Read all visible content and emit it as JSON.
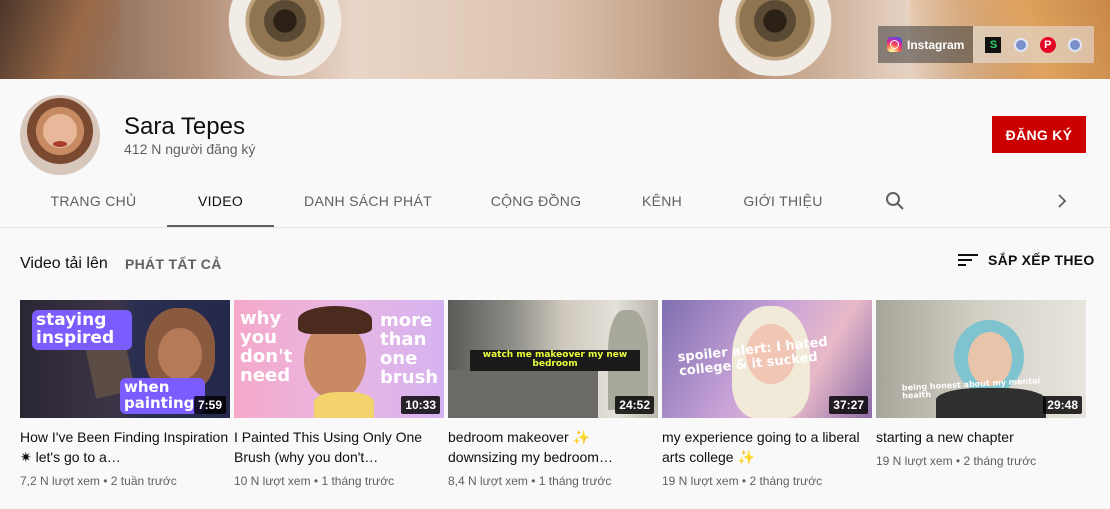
{
  "banner": {
    "links": {
      "primary_label": "Instagram",
      "icons": [
        "instagram-icon",
        "s-app-icon",
        "globe-icon",
        "pinterest-icon",
        "globe-icon"
      ]
    }
  },
  "channel": {
    "name": "Sara Tepes",
    "subscribers": "412 N người đăng ký",
    "subscribe_label": "ĐĂNG KÝ"
  },
  "tabs": [
    {
      "label": "TRANG CHỦ",
      "active": false
    },
    {
      "label": "VIDEO",
      "active": true
    },
    {
      "label": "DANH SÁCH PHÁT",
      "active": false
    },
    {
      "label": "CỘNG ĐỒNG",
      "active": false
    },
    {
      "label": "KÊNH",
      "active": false
    },
    {
      "label": "GIỚI THIỆU",
      "active": false
    }
  ],
  "section": {
    "title": "Video tải lên",
    "play_all": "PHÁT TẤT CẢ",
    "sort_label": "SẮP XẾP THEO"
  },
  "videos": [
    {
      "title": "How I've Been Finding Inspiration ✷ let's go to a…",
      "duration": "7:59",
      "views": "7,2 N lượt xem",
      "age": "2 tuần trước",
      "thumb_text": [
        "staying inspired",
        "when painting"
      ]
    },
    {
      "title": "I Painted This Using Only One Brush (why you don't…",
      "duration": "10:33",
      "views": "10 N lượt xem",
      "age": "1 tháng trước",
      "thumb_text": [
        "why you don't need",
        "more than one brush"
      ]
    },
    {
      "title": "bedroom makeover ✨ downsizing my bedroom…",
      "duration": "24:52",
      "views": "8,4 N lượt xem",
      "age": "1 tháng trước",
      "thumb_text": [
        "watch me makeover my new bedroom"
      ]
    },
    {
      "title": "my experience going to a liberal arts college ✨",
      "duration": "37:27",
      "views": "19 N lượt xem",
      "age": "2 tháng trước",
      "thumb_text": [
        "spoiler alert: I hated college & it sucked"
      ]
    },
    {
      "title": "starting a new chapter",
      "duration": "29:48",
      "views": "19 N lượt xem",
      "age": "2 tháng trước",
      "thumb_text": [
        "being honest about my mental health"
      ]
    }
  ]
}
